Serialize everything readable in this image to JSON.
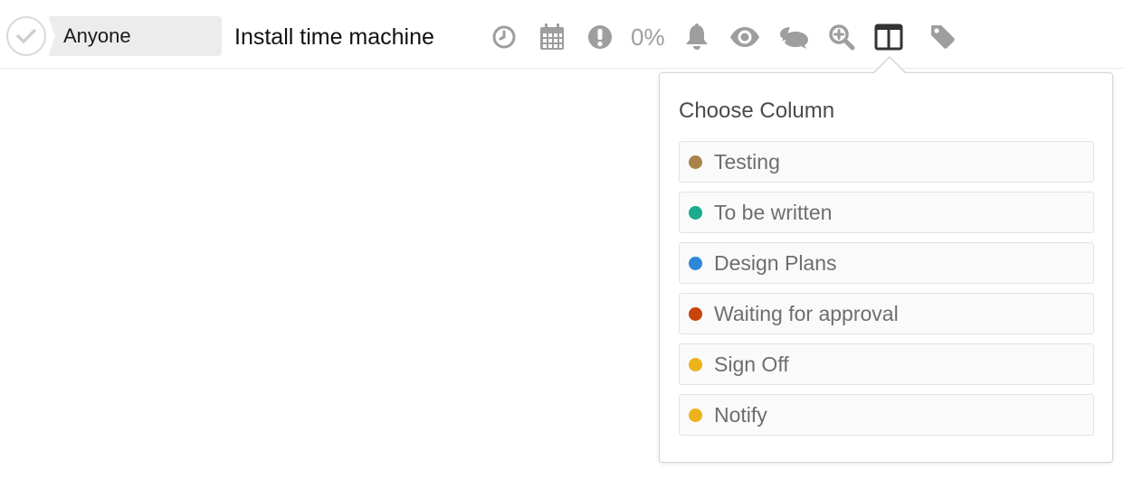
{
  "task": {
    "assignee": "Anyone",
    "title": "Install time machine",
    "progress": "0%"
  },
  "toolbar_icons": [
    {
      "name": "clock-icon"
    },
    {
      "name": "calendar-icon"
    },
    {
      "name": "priority-icon"
    },
    {
      "name": "bell-icon"
    },
    {
      "name": "eye-icon"
    },
    {
      "name": "comments-icon"
    },
    {
      "name": "zoom-in-icon"
    },
    {
      "name": "columns-icon"
    },
    {
      "name": "tag-icon"
    }
  ],
  "column_popover": {
    "title": "Choose Column",
    "columns": [
      {
        "label": "Testing",
        "color": "#a8844a"
      },
      {
        "label": "To be written",
        "color": "#1aac8c"
      },
      {
        "label": "Design Plans",
        "color": "#2e86d6"
      },
      {
        "label": "Waiting for approval",
        "color": "#c9440c"
      },
      {
        "label": "Sign Off",
        "color": "#ecb31a"
      },
      {
        "label": "Notify",
        "color": "#ecb31a"
      }
    ]
  }
}
